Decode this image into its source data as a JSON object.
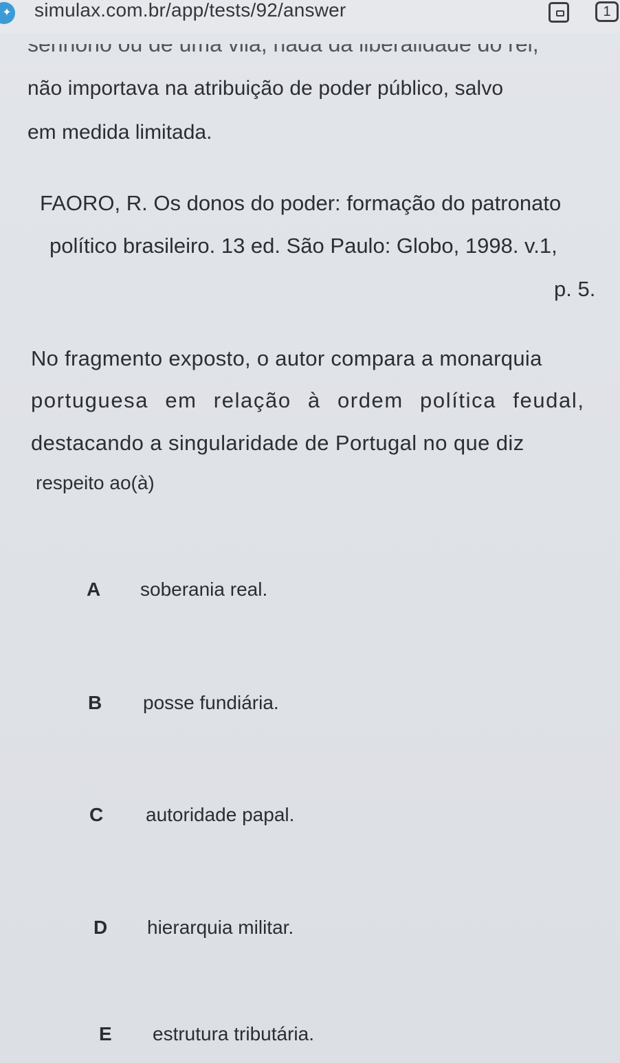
{
  "browser": {
    "url": "simulax.com.br/app/tests/92/answer",
    "tab_count": "1",
    "site_icon": "site-favicon-icon",
    "tabs_icon": "tabs-icon"
  },
  "content": {
    "cut_off_line": "senhorio ou de uma vila, nada da liberalidade do rei,",
    "paragraph_line1": "não importava na atribuição de poder público, salvo",
    "paragraph_line2": "em medida limitada.",
    "citation_line1": "FAORO, R. Os donos do poder: formação do patronato",
    "citation_line2": "político brasileiro. 13 ed. São Paulo: Globo, 1998. v.1,",
    "citation_line3": "p. 5.",
    "question_line1": "No fragmento exposto, o autor compara a monarquia",
    "question_line2": "portuguesa em relação à ordem política feudal,",
    "question_line3": "destacando a singularidade de Portugal no que diz",
    "question_line4": "respeito ao(à)"
  },
  "options": [
    {
      "letter": "A",
      "text": "soberania real."
    },
    {
      "letter": "B",
      "text": "posse fundiária."
    },
    {
      "letter": "C",
      "text": "autoridade papal."
    },
    {
      "letter": "D",
      "text": "hierarquia militar."
    },
    {
      "letter": "E",
      "text": "estrutura tributária."
    }
  ]
}
